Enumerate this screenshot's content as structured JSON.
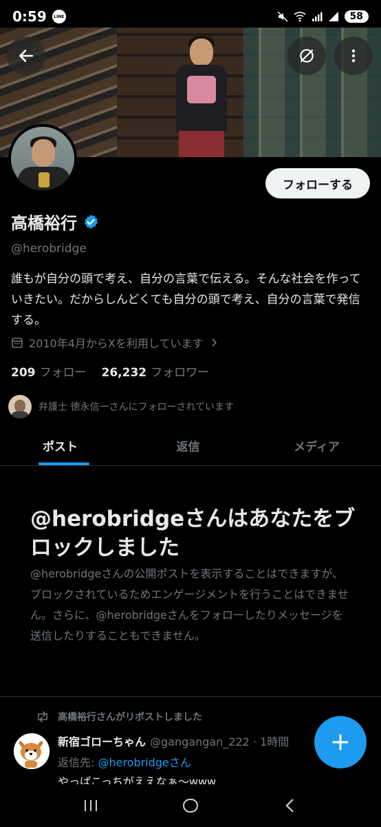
{
  "status_bar": {
    "time": "0:59",
    "line_badge": "LINE",
    "battery": "58"
  },
  "profile": {
    "follow_button": "フォローする",
    "display_name": "高橋裕行",
    "handle": "@herobridge",
    "bio": "誰もが自分の頭で考え、自分の言葉で伝える。そんな社会を作っていきたい。だからしんどくても自分の頭で考え、自分の言葉で発信する。",
    "joined": "2010年4月からXを利用しています",
    "following_count": "209",
    "following_label": "フォロー",
    "followers_count": "26,232",
    "followers_label": "フォロワー",
    "followed_by": "弁護士 徳永信一さんにフォローされています"
  },
  "tabs": [
    {
      "label": "ポスト",
      "active": true
    },
    {
      "label": "返信",
      "active": false
    },
    {
      "label": "メディア",
      "active": false
    }
  ],
  "blocked": {
    "title": "@herobridgeさんはあなたをブロックしました",
    "description": "@herobridgeさんの公開ポストを表示することはできますが、ブロックされているためエンゲージメントを行うことはできません。さらに、@herobridgeさんをフォローしたりメッセージを送信したりすることもできません。"
  },
  "tweet": {
    "repost_label": "高橋裕行さんがリポストしました",
    "author_name": "新宿ゴローちゃん",
    "author_handle": "@gangangan_222 · 1時間",
    "reply_prefix": "返信先:",
    "reply_to": "@herobridgeさん",
    "text": "やっぱこっちがええなぁ〜www"
  },
  "icons": {
    "back": "arrow-left-icon",
    "grok": "grok-icon",
    "more": "more-vertical-icon",
    "verified": "verified-badge-icon",
    "calendar": "calendar-icon",
    "chevron": "chevron-right-icon",
    "repost": "repost-icon",
    "compose": "plus-icon"
  },
  "colors": {
    "accent": "#1d9bf0",
    "background": "#000000",
    "muted": "#71767b"
  }
}
